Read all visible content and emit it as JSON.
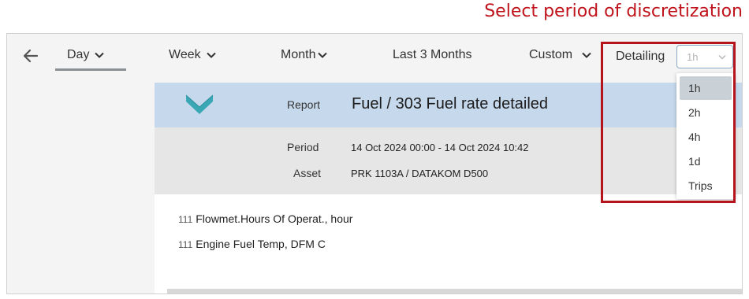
{
  "annotation": {
    "text": "Select period of discretization",
    "color": "#c0141c"
  },
  "toolbar": {
    "tabs": [
      {
        "label": "Day",
        "active": true,
        "has_dropdown": true
      },
      {
        "label": "Week",
        "has_dropdown": true
      },
      {
        "label": "Month",
        "has_dropdown": true
      },
      {
        "label": "Last 3 Months",
        "has_dropdown": false
      },
      {
        "label": "Custom",
        "has_dropdown": true
      }
    ],
    "detailing": {
      "label": "Detailing",
      "selected": "1h",
      "options": [
        "1h",
        "2h",
        "4h",
        "1d",
        "Trips"
      ]
    }
  },
  "report": {
    "label": "Report",
    "title": "Fuel / 303 Fuel rate detailed",
    "period_label": "Period",
    "period_value": "14 Oct 2024 00:00 - 14 Oct 2024 10:42",
    "asset_label": "Asset",
    "asset_value": "PRK 1103A / DATAKOM D500",
    "metrics": [
      {
        "code": "111",
        "name": "Flowmet.Hours Of Operat., hour"
      },
      {
        "code": "111",
        "name": "Engine Fuel Temp, DFM C"
      }
    ]
  },
  "colors": {
    "header_bg": "#c6d8ec",
    "meta_bg": "#e6e6e6",
    "logo": "#3aa7b5",
    "highlight": "#b5141d"
  }
}
